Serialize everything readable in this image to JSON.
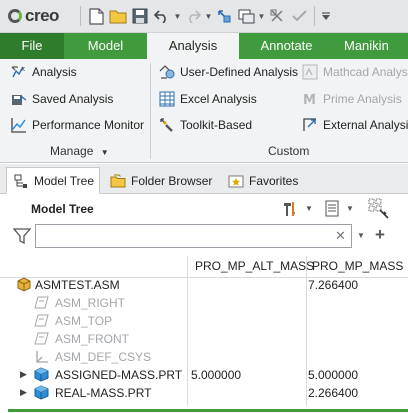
{
  "app": {
    "logo_text": "creo"
  },
  "quick_access": {
    "icons": [
      "new-file-icon",
      "open-folder-icon",
      "save-icon",
      "undo-icon",
      "redo-icon",
      "regenerate-icon",
      "window-icon",
      "close-window-icon",
      "checkmark-icon",
      "customize-icon"
    ]
  },
  "ribbon_tabs": [
    "File",
    "Model",
    "Analysis",
    "Annotate",
    "Manikin"
  ],
  "active_tab": "Analysis",
  "ribbon": {
    "manage": {
      "buttons": [
        "Analysis",
        "Saved Analysis",
        "Performance Monitor"
      ],
      "group_label": "Manage"
    },
    "custom": {
      "buttons": [
        "User-Defined Analysis",
        "Excel Analysis",
        "Toolkit-Based",
        "Mathcad Analysis",
        "Prime Analysis",
        "External Analysis"
      ],
      "group_label": "Custom"
    }
  },
  "navigator_tabs": [
    "Model Tree",
    "Folder Browser",
    "Favorites"
  ],
  "model_tree": {
    "title": "Model Tree",
    "filter_value": "",
    "columns": [
      "PRO_MP_ALT_MASS",
      "PRO_MP_MASS"
    ],
    "rows": [
      {
        "label": "ASMTEST.ASM",
        "alt_mass": "",
        "mass": "7.266400"
      },
      {
        "label": "ASM_RIGHT",
        "alt_mass": "",
        "mass": ""
      },
      {
        "label": "ASM_TOP",
        "alt_mass": "",
        "mass": ""
      },
      {
        "label": "ASM_FRONT",
        "alt_mass": "",
        "mass": ""
      },
      {
        "label": "ASM_DEF_CSYS",
        "alt_mass": "",
        "mass": ""
      },
      {
        "label": "ASSIGNED-MASS.PRT",
        "alt_mass": "5.000000",
        "mass": "5.000000"
      },
      {
        "label": "REAL-MASS.PRT",
        "alt_mass": "",
        "mass": "2.266400"
      }
    ]
  },
  "colors": {
    "ribbon_green": "#3f9b3d",
    "file_tab": "#2f7c2d",
    "part_blue": "#2b8fd6"
  }
}
